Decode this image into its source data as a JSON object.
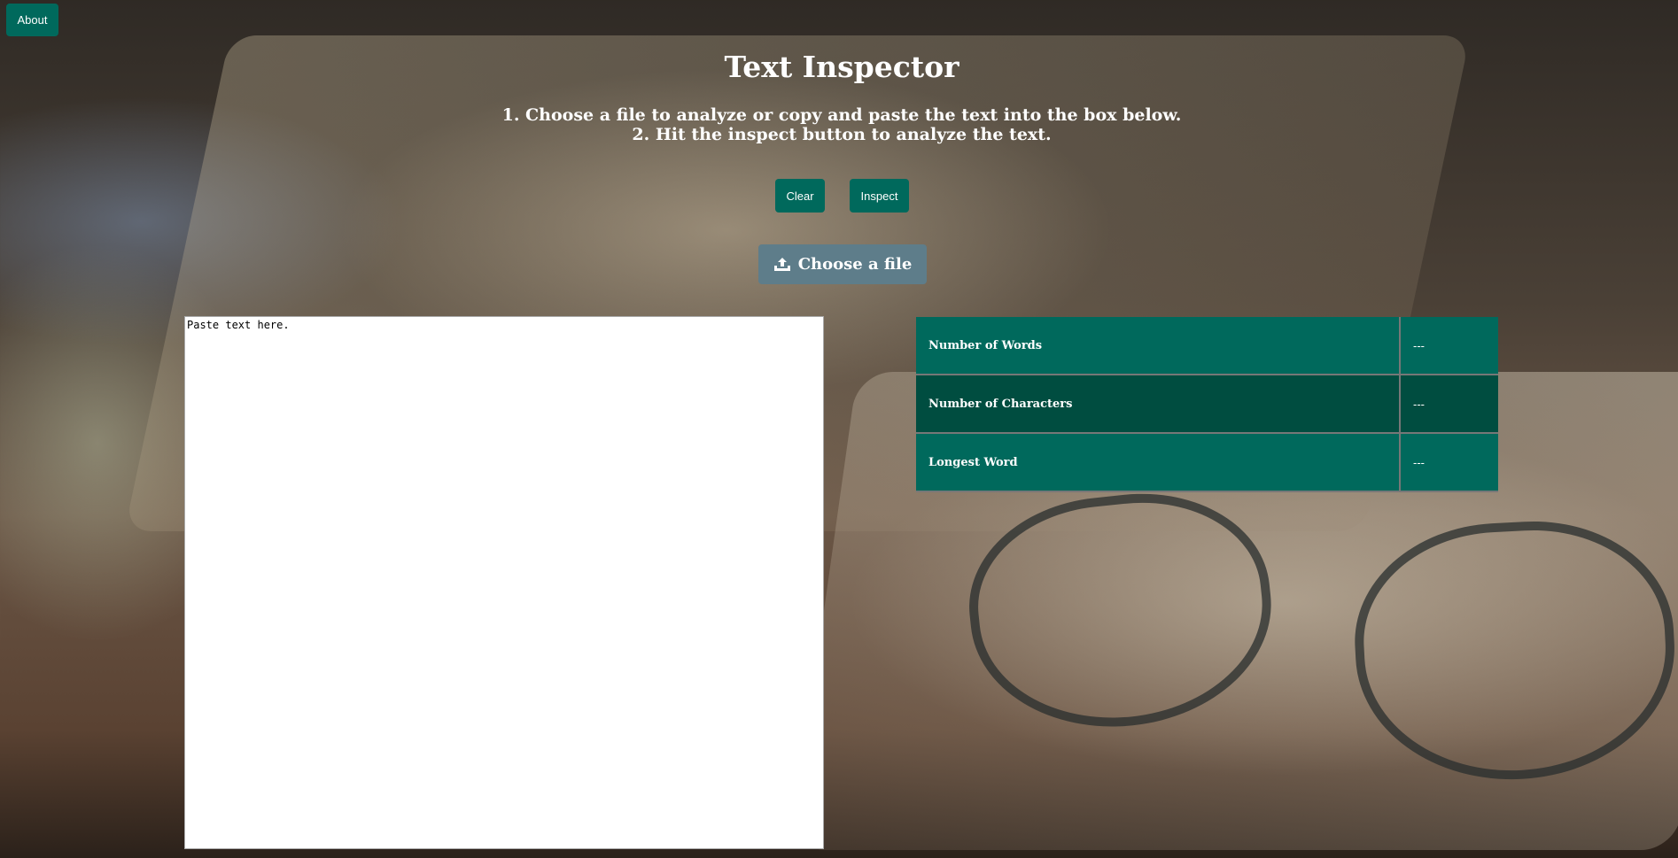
{
  "nav": {
    "about_label": "About"
  },
  "header": {
    "title": "Text Inspector",
    "instructions": [
      "1. Choose a file to analyze or copy and paste the text into the box below.",
      "2. Hit the inspect button to analyze the text."
    ]
  },
  "actions": {
    "clear_label": "Clear",
    "inspect_label": "Inspect"
  },
  "upload": {
    "label": "Choose a file",
    "icon": "upload-icon"
  },
  "editor": {
    "placeholder": "Paste text here.",
    "value": ""
  },
  "stats": {
    "rows": [
      {
        "label": "Number of Words",
        "value": "---"
      },
      {
        "label": "Number of Characters",
        "value": "---"
      },
      {
        "label": "Longest Word",
        "value": "---"
      }
    ]
  },
  "colors": {
    "primary": "#00695c",
    "primary_dark": "#004d40",
    "upload_button": "#5e7d8a",
    "text": "#ffffff"
  }
}
